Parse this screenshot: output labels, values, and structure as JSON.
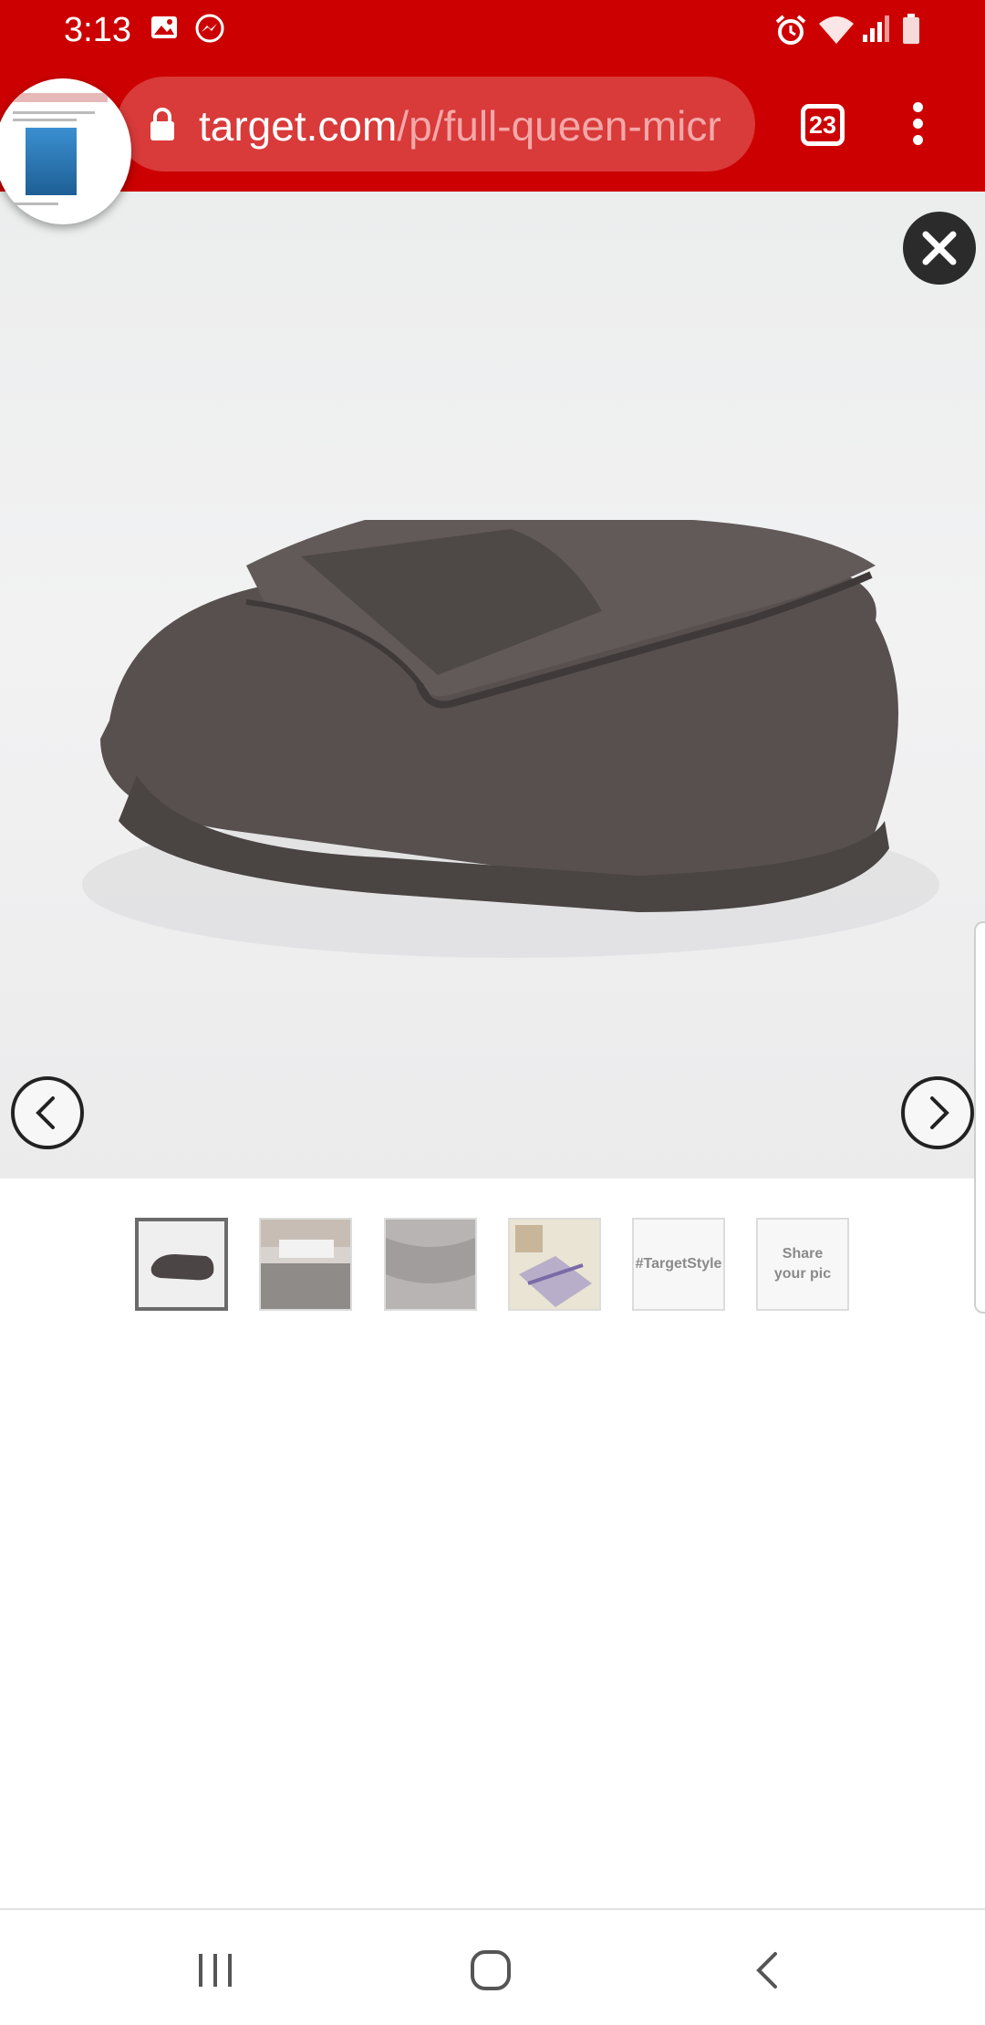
{
  "status_bar": {
    "time": "3:13",
    "background": "#cc0000",
    "icons": [
      "gallery-icon",
      "messenger-icon",
      "alarm-icon",
      "wifi-icon",
      "signal-icon",
      "battery-icon"
    ]
  },
  "browser": {
    "url_domain": "target.com",
    "url_path": "/p/full-queen-micr",
    "tab_count": "23",
    "menu_icon": "more-vert-icon"
  },
  "product_viewer": {
    "close_icon": "close-icon",
    "prev_icon": "chevron-left-icon",
    "next_icon": "chevron-right-icon",
    "thumbnails": [
      {
        "kind": "image",
        "label": "",
        "selected": true
      },
      {
        "kind": "image",
        "label": "",
        "selected": false
      },
      {
        "kind": "image",
        "label": "",
        "selected": false
      },
      {
        "kind": "image",
        "label": "",
        "selected": false
      },
      {
        "kind": "text",
        "label": "#TargetStyle",
        "selected": false
      },
      {
        "kind": "text",
        "label": "Share your pic",
        "selected": false
      }
    ]
  },
  "system_nav": {
    "icons": [
      "recent-apps-icon",
      "home-icon",
      "back-icon"
    ]
  }
}
